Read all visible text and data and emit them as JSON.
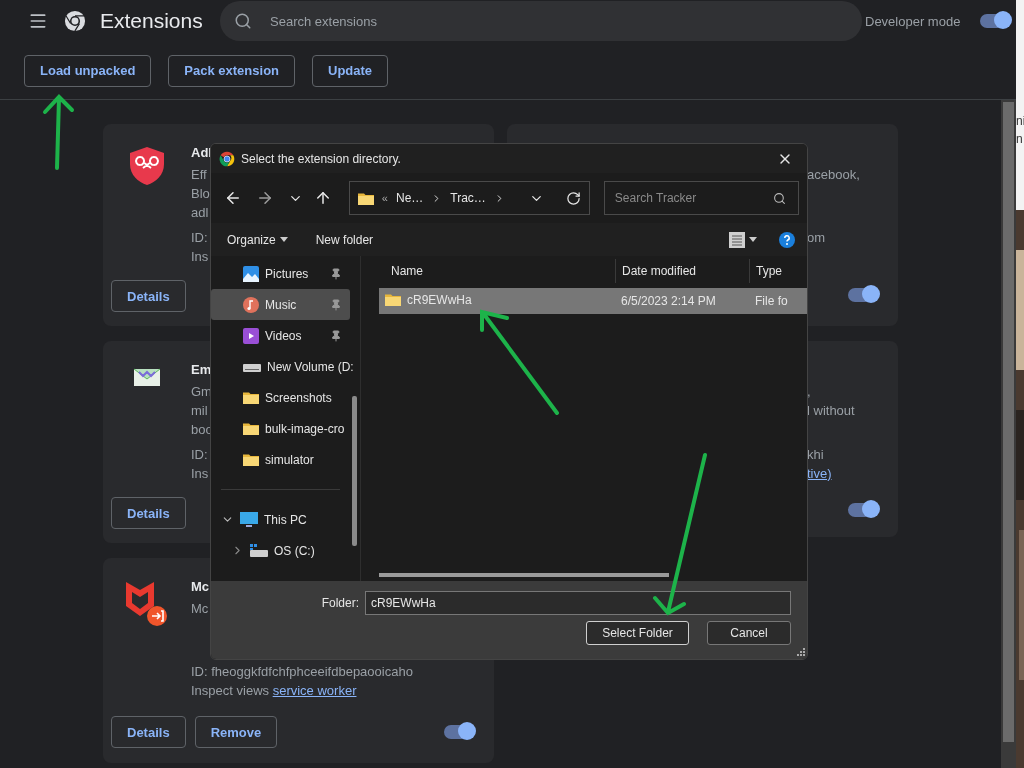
{
  "header": {
    "title": "Extensions",
    "search": {
      "placeholder": "Search extensions"
    },
    "developer_mode": {
      "label": "Developer mode",
      "on": true
    }
  },
  "toolbar": {
    "buttons": [
      "Load unpacked",
      "Pack extension",
      "Update"
    ]
  },
  "left_cards": [
    {
      "kind": "shield",
      "title": "Adl",
      "description": [
        "Eff",
        "Blo",
        "adl"
      ],
      "id_line": "ID:",
      "inspect": {
        "label": "Ins"
      },
      "buttons": [
        "Details"
      ]
    },
    {
      "kind": "mail",
      "title": "Em",
      "description": [
        "Gm",
        "mil",
        "boo"
      ],
      "id_line": "ID:",
      "inspect": {
        "label": "Ins"
      },
      "buttons": [
        "Details"
      ]
    },
    {
      "kind": "mcafee",
      "title": "Mc",
      "description": [
        "Mc"
      ],
      "id_line": "ID: fheoggkfdfchfphceeifdbepaooicaho",
      "inspect": {
        "label": "Inspect views",
        "link": "service worker"
      },
      "buttons": [
        "Details",
        "Remove"
      ],
      "on": true
    }
  ],
  "right_cards": [
    {
      "description": [
        "acebook,"
      ],
      "id_line": "om",
      "on": true
    },
    {
      "description": [
        ",",
        "l without"
      ],
      "id_line": "khi",
      "inspect": {
        "link": "tive)"
      },
      "on": true
    }
  ],
  "side_strip": {
    "lines": [
      "ni",
      "n"
    ]
  },
  "dialog": {
    "title": "Select the extension directory.",
    "address": {
      "separator": "«",
      "crumbs": [
        "Ne…",
        "Trac…"
      ]
    },
    "search": {
      "placeholder": "Search Tracker"
    },
    "commands": {
      "organize": "Organize",
      "new_folder": "New folder"
    },
    "quick_access": [
      {
        "kind": "pictures",
        "label": "Pictures",
        "pinned": true,
        "selected": false
      },
      {
        "kind": "music",
        "label": "Music",
        "pinned": true,
        "selected": true
      },
      {
        "kind": "videos",
        "label": "Videos",
        "pinned": true,
        "selected": false
      },
      {
        "kind": "drive",
        "label": "New Volume (D:",
        "pinned": false,
        "selected": false
      },
      {
        "kind": "folder",
        "label": "Screenshots",
        "pinned": false,
        "selected": false
      },
      {
        "kind": "folder",
        "label": "bulk-image-cro",
        "pinned": false,
        "selected": false
      },
      {
        "kind": "folder",
        "label": "simulator",
        "pinned": false,
        "selected": false
      }
    ],
    "tree": [
      {
        "kind": "pc",
        "label": "This PC",
        "expanded": true,
        "children": [
          {
            "kind": "osdrive",
            "label": "OS (C:)",
            "expanded": false
          }
        ]
      }
    ],
    "columns": [
      "Name",
      "Date modified",
      "Type"
    ],
    "rows": [
      {
        "name": "cR9EWwHa",
        "date": "6/5/2023 2:14 PM",
        "type": "File fo",
        "selected": true
      }
    ],
    "folder_label": "Folder:",
    "folder_value": "cR9EWwHa",
    "buttons": [
      "Select Folder",
      "Cancel"
    ]
  }
}
